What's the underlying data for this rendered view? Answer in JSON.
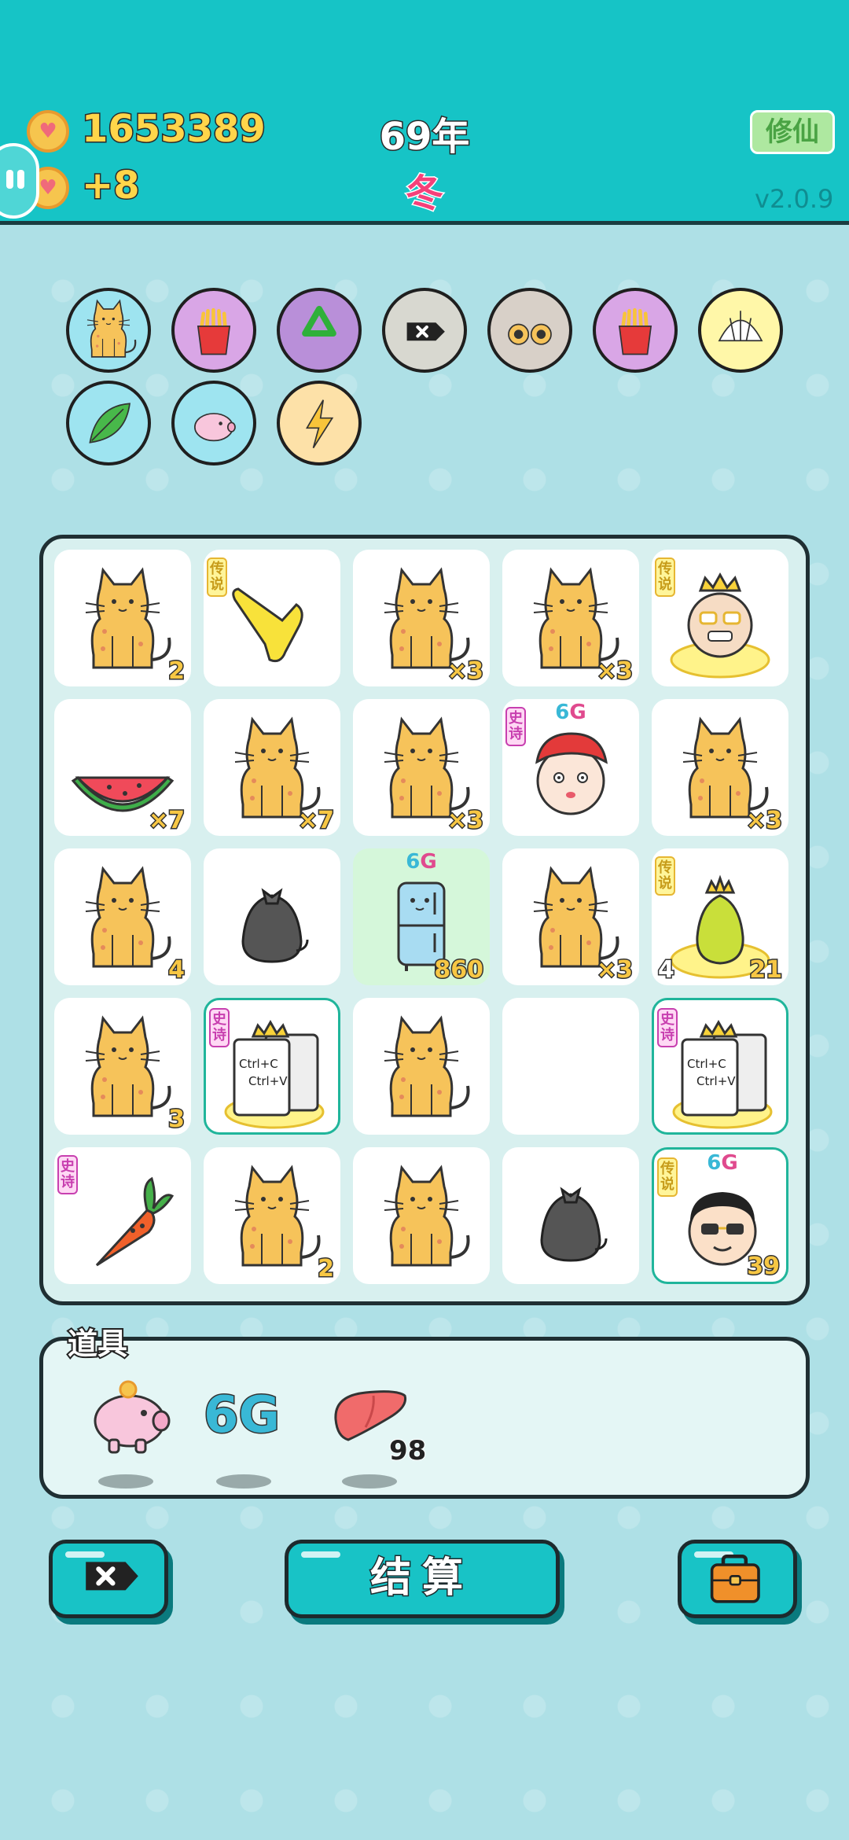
{
  "header": {
    "coins": "1653389",
    "income": "+8",
    "year": "69年",
    "season": "冬",
    "cultivate_button": "修仙",
    "version": "v2.0.9"
  },
  "badges": [
    {
      "icon": "cat-coin-icon",
      "bg": "#9ee4f0"
    },
    {
      "icon": "fries-coin-icon",
      "bg": "#d9a6e6"
    },
    {
      "icon": "recycle-icon",
      "bg": "#b98fd9"
    },
    {
      "icon": "delete-coin-icon",
      "bg": "#d8d8d0"
    },
    {
      "icon": "cat-eyes-icon",
      "bg": "#d8d0c8"
    },
    {
      "icon": "fries-coin-icon",
      "bg": "#d9a6e6"
    },
    {
      "icon": "shell-icon",
      "bg": "#fff7a8"
    },
    {
      "icon": "leaf-coin-icon",
      "bg": "#9ee4f0"
    },
    {
      "icon": "piggy-bank-icon",
      "bg": "#9ee4f0"
    },
    {
      "icon": "lightning-icon",
      "bg": "#fde1a8"
    }
  ],
  "board": {
    "rows": [
      [
        {
          "item": "cat",
          "qty": "2"
        },
        {
          "item": "pointing-hand",
          "tag": "传说"
        },
        {
          "item": "cat",
          "qty": "×3"
        },
        {
          "item": "cat",
          "qty": "×3"
        },
        {
          "item": "king-face",
          "tag": "传说"
        }
      ],
      [
        {
          "item": "watermelon",
          "qty": "×7"
        },
        {
          "item": "cat",
          "qty": "×7"
        },
        {
          "item": "cat",
          "qty": "×3"
        },
        {
          "item": "red-hat-boy",
          "tag": "史诗",
          "badge6g": "6G"
        },
        {
          "item": "cat",
          "qty": "×3"
        }
      ],
      [
        {
          "item": "cat",
          "qty": "4"
        },
        {
          "item": "trash-bag"
        },
        {
          "item": "fridge",
          "qty": "860",
          "badge6g": "6G"
        },
        {
          "item": "cat",
          "qty": "×3"
        },
        {
          "item": "crowned-pear",
          "tag": "传说",
          "level": "4",
          "qty": "21"
        }
      ],
      [
        {
          "item": "cat",
          "qty": "3"
        },
        {
          "item": "ctrl-cv",
          "tag": "史诗",
          "line1": "Ctrl+C",
          "line2": "Ctrl+V"
        },
        {
          "item": "cat"
        },
        {
          "item": "empty"
        },
        {
          "item": "ctrl-cv",
          "tag": "史诗",
          "line1": "Ctrl+C",
          "line2": "Ctrl+V"
        }
      ],
      [
        {
          "item": "carrot",
          "tag": "史诗"
        },
        {
          "item": "cat",
          "qty": "2"
        },
        {
          "item": "cat"
        },
        {
          "item": "trash-bag"
        },
        {
          "item": "sunglasses-man",
          "tag": "传说",
          "badge6g": "6G",
          "qty": "39"
        }
      ]
    ]
  },
  "tools": {
    "label": "道具",
    "items": [
      {
        "icon": "piggy-bank-icon"
      },
      {
        "icon": "6g-icon",
        "text": "6G"
      },
      {
        "icon": "liver-icon",
        "count": "98"
      }
    ]
  },
  "buttons": {
    "delete_icon": "delete-icon",
    "settle": "结算",
    "bag_icon": "briefcase-icon"
  },
  "colors": {
    "header": "#16c4c6",
    "background": "#aee0e6",
    "accent": "#18c3c6",
    "coin_text": "#ffd54a",
    "season": "#f5407a"
  }
}
